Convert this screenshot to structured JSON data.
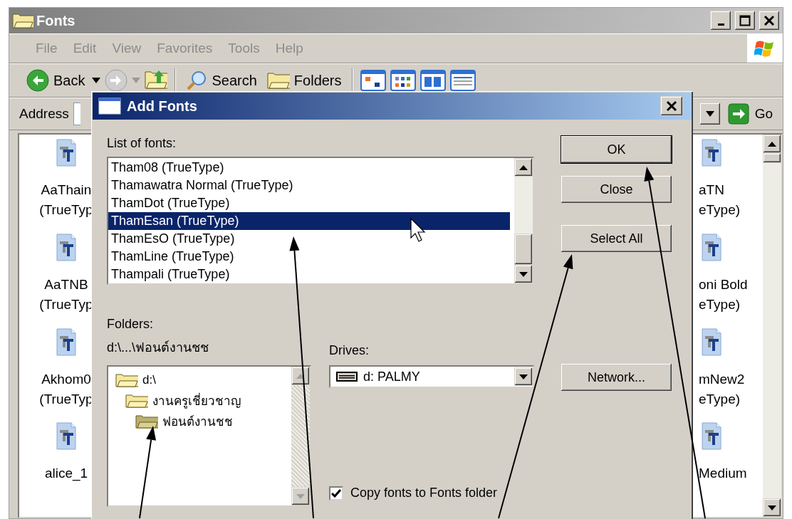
{
  "window": {
    "title": "Fonts"
  },
  "menu": [
    "File",
    "Edit",
    "View",
    "Favorites",
    "Tools",
    "Help"
  ],
  "toolbar": {
    "back": "Back",
    "search": "Search",
    "folders": "Folders"
  },
  "address": {
    "label": "Address",
    "go": "Go"
  },
  "files_left": [
    {
      "name": "AaThain",
      "type": "(TrueTyp"
    },
    {
      "name": "AaTNB",
      "type": "(TrueTyp"
    },
    {
      "name": "Akhom0",
      "type": "(TrueTyp"
    },
    {
      "name": "alice_1"
    }
  ],
  "files_right": [
    {
      "name": "aTN",
      "type": "eType)"
    },
    {
      "name": "oni Bold",
      "type": "eType)"
    },
    {
      "name": "mNew2",
      "type": "eType)"
    },
    {
      "name": "Medium"
    }
  ],
  "dialog": {
    "title": "Add Fonts",
    "list_label": "List of fonts:",
    "fonts": [
      {
        "label": "Tham08 (TrueType)",
        "selected": false
      },
      {
        "label": "Thamawatra Normal (TrueType)",
        "selected": false
      },
      {
        "label": "ThamDot (TrueType)",
        "selected": false
      },
      {
        "label": "ThamEsan (TrueType)",
        "selected": true
      },
      {
        "label": "ThamEsO (TrueType)",
        "selected": false
      },
      {
        "label": "ThamLine (TrueType)",
        "selected": false
      },
      {
        "label": "Thampali (TrueType)",
        "selected": false
      }
    ],
    "folders_label": "Folders:",
    "folder_path": "d:\\...\\ฟอนต์งานชช",
    "folders": [
      {
        "label": "d:\\",
        "children": [
          {
            "label": "งานครูเชี่ยวชาญ",
            "children": [
              {
                "label": "ฟอนต์งานชช"
              }
            ]
          }
        ]
      }
    ],
    "drives_label": "Drives:",
    "drive": "d: PALMY",
    "buttons": [
      {
        "label": "OK",
        "default": true
      },
      {
        "label": "Close",
        "default": false
      },
      {
        "label": "Select All",
        "default": false
      },
      {
        "label": "Network...",
        "default": false
      }
    ],
    "copy_option": {
      "label": "Copy fonts to Fonts folder",
      "checked": true
    }
  }
}
